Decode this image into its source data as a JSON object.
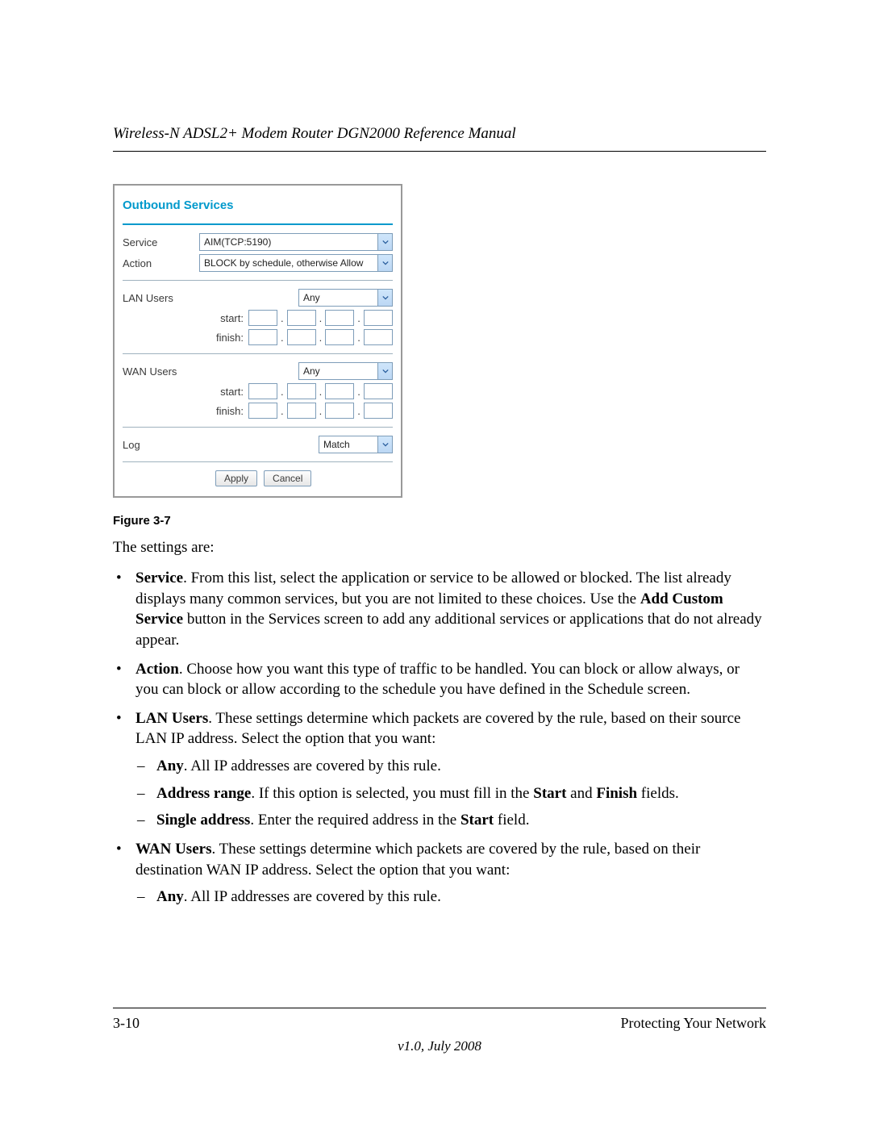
{
  "header": {
    "title": "Wireless-N ADSL2+ Modem Router DGN2000 Reference Manual"
  },
  "figure": {
    "panel_title": "Outbound Services",
    "labels": {
      "service": "Service",
      "action": "Action",
      "lan_users": "LAN Users",
      "wan_users": "WAN Users",
      "log": "Log",
      "start": "start:",
      "finish": "finish:"
    },
    "values": {
      "service": "AIM(TCP:5190)",
      "action": "BLOCK by schedule, otherwise Allow",
      "lan_users_sel": "Any",
      "wan_users_sel": "Any",
      "log_sel": "Match"
    },
    "buttons": {
      "apply": "Apply",
      "cancel": "Cancel"
    },
    "caption": "Figure 3-7"
  },
  "body": {
    "intro": "The settings are:",
    "items": [
      {
        "term": "Service",
        "text_a": ". From this list, select the application or service to be allowed or blocked. The list already displays many common services, but you are not limited to these choices. Use the ",
        "term_b": "Add Custom Service",
        "text_b": " button in the Services screen to add any additional services or applications that do not already appear."
      },
      {
        "term": "Action",
        "text_a": ". Choose how you want this type of traffic to be handled. You can block or allow always, or you can block or allow according to the schedule you have defined in the Schedule screen."
      },
      {
        "term": "LAN Users",
        "text_a": ". These settings determine which packets are covered by the rule, based on their source LAN IP address. Select the option that you want:",
        "subs": [
          {
            "term": "Any",
            "text": ". All IP addresses are covered by this rule."
          },
          {
            "term": "Address range",
            "text_a": ". If this option is selected, you must fill in the ",
            "t1": "Start",
            "and": " and ",
            "t2": "Finish",
            "tail": " fields."
          },
          {
            "term": "Single address",
            "text_a": ". Enter the required address in the ",
            "t1": "Start",
            "tail": " field."
          }
        ]
      },
      {
        "term": "WAN Users",
        "text_a": ". These settings determine which packets are covered by the rule, based on their destination WAN IP address. Select the option that you want:",
        "subs": [
          {
            "term": "Any",
            "text": ". All IP addresses are covered by this rule."
          }
        ]
      }
    ]
  },
  "footer": {
    "page": "3-10",
    "section": "Protecting Your Network",
    "version": "v1.0, July 2008"
  }
}
